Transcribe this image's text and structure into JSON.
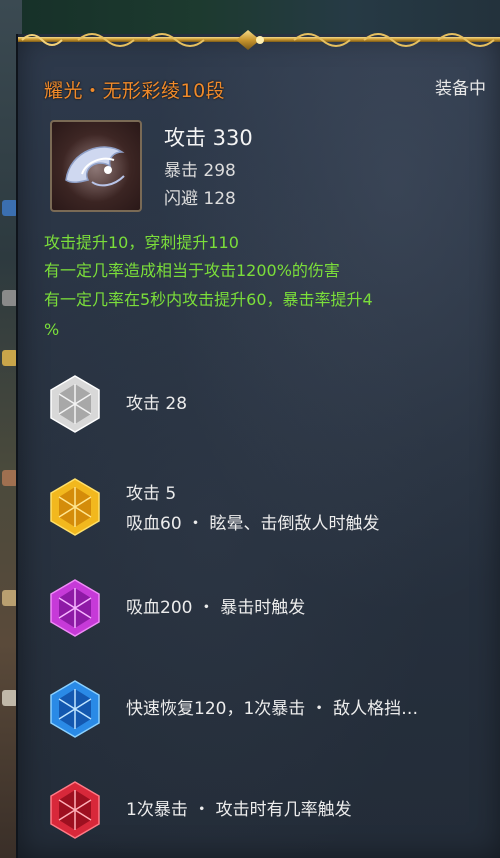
{
  "tooltip": {
    "title": "耀光・无形彩绫10段",
    "status": "装备中",
    "main_stat": "攻击 330",
    "sub_stats": [
      "暴击 298",
      "闪避 128"
    ],
    "effects": [
      "攻击提升10，穿刺提升110",
      "有一定几率造成相当于攻击1200%的伤害",
      "有一定几率在5秒内攻击提升60，暴击率提升4",
      "%"
    ],
    "gems": [
      {
        "color": "white",
        "lines": [
          "攻击 28"
        ]
      },
      {
        "color": "yellow",
        "lines": [
          "攻击 5",
          "吸血60 ・ 眩晕、击倒敌人时触发"
        ]
      },
      {
        "color": "purple",
        "lines": [
          "吸血200 ・ 暴击时触发"
        ]
      },
      {
        "color": "blue",
        "lines": [
          "快速恢复120，1次暴击 ・ 敌人格挡…"
        ]
      },
      {
        "color": "red",
        "lines": [
          "1次暴击 ・ 攻击时有几率触发"
        ]
      }
    ]
  },
  "colors": {
    "title": "#f08a2a",
    "effect_text": "#7bde3a",
    "panel_bg": "#27313f",
    "gold": "#d8b04a"
  }
}
